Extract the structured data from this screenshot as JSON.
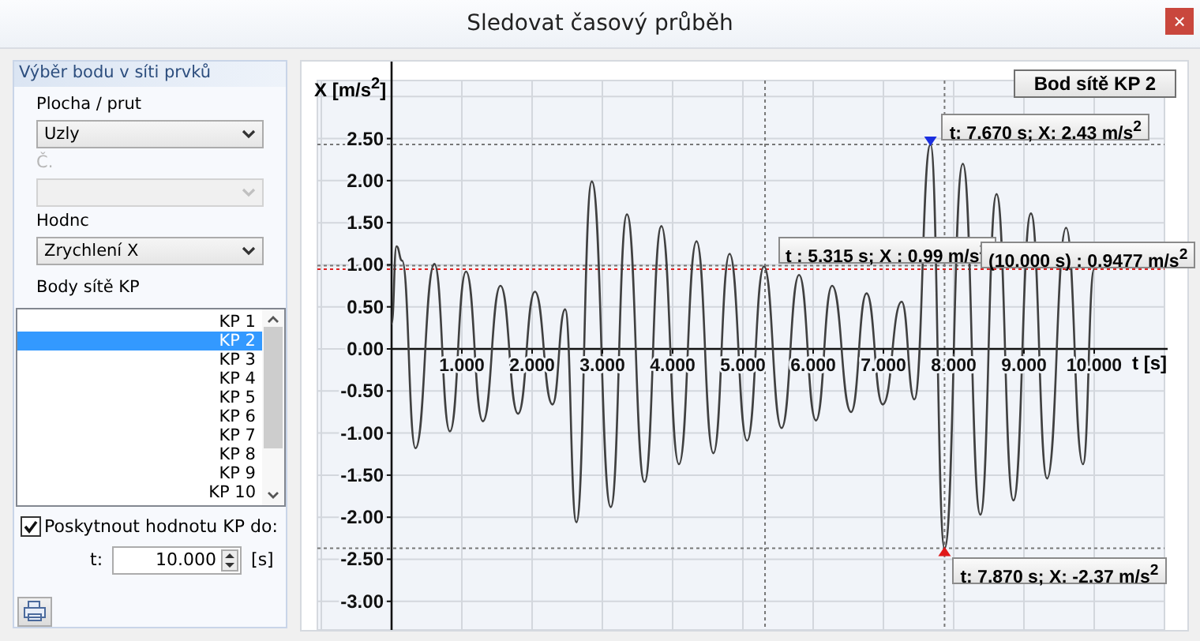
{
  "window": {
    "title": "Sledovat časový průběh",
    "close": "×"
  },
  "point_selection": {
    "title": "Výběr bodu v síti prvků",
    "fields": [
      {
        "label": "Plocha / prut",
        "value": "Uzly",
        "disabled": false
      },
      {
        "label": "Č.",
        "disabled": true
      },
      {
        "label": "Hodnc",
        "value": "Zrychlení X",
        "disabled": false
      }
    ],
    "mesh_points_label": "Body sítě KP",
    "mesh_points": [
      {
        "label": "KP 1",
        "selected": false
      },
      {
        "label": "KP 2",
        "selected": true
      },
      {
        "label": "KP 3",
        "selected": false
      },
      {
        "label": "KP 4",
        "selected": false
      },
      {
        "label": "KP 5",
        "selected": false
      },
      {
        "label": "KP 6",
        "selected": false
      },
      {
        "label": "KP 7",
        "selected": false
      },
      {
        "label": "KP 8",
        "selected": false
      },
      {
        "label": "KP 9",
        "selected": false
      },
      {
        "label": "KP 10",
        "selected": false
      }
    ],
    "limit": {
      "label": "Poskytnout hodnotu KP do:",
      "checked": true,
      "field_label": "t:",
      "value": "10.000",
      "unit": "[s]"
    }
  },
  "chart": {
    "chart_data": {
      "type": "line",
      "xlabel": "t [s]",
      "ylabel": "X [m/s$^{2}$]",
      "grid": true,
      "xlim": [
        -1,
        11
      ],
      "ylim": [
        -3.34,
        3.19
      ],
      "xticks": [
        {
          "value": 1,
          "label": "1.000"
        },
        {
          "value": 2,
          "label": "2.000"
        },
        {
          "value": 3,
          "label": "3.000"
        },
        {
          "value": 4,
          "label": "4.000"
        },
        {
          "value": 5,
          "label": "5.000"
        },
        {
          "value": 6,
          "label": "6.000"
        },
        {
          "value": 7,
          "label": "7.000"
        },
        {
          "value": 8,
          "label": "8.000"
        },
        {
          "value": 9,
          "label": "9.000"
        },
        {
          "value": 10,
          "label": "10.000"
        }
      ],
      "yticks": [
        {
          "value": 2.5,
          "label": "2.50"
        },
        {
          "value": 2,
          "label": "2.00"
        },
        {
          "value": 1.5,
          "label": "1.50"
        },
        {
          "value": 1,
          "label": "1.00"
        },
        {
          "value": 0.5,
          "label": "0.50"
        },
        {
          "value": 0,
          "label": "0.00"
        },
        {
          "value": -0.5,
          "label": "-0.50"
        },
        {
          "value": -1,
          "label": "-1.00"
        },
        {
          "value": -1.5,
          "label": "-1.50"
        },
        {
          "value": -2,
          "label": "-2.00"
        },
        {
          "value": -2.5,
          "label": "-2.50"
        },
        {
          "value": -3,
          "label": "-3.00"
        }
      ],
      "x": [
        0,
        0.07,
        0.15,
        0.34,
        0.61,
        0.83,
        1.06,
        1.3,
        1.55,
        1.8,
        2.04,
        2.29,
        2.47,
        2.63,
        2.85,
        3.12,
        3.35,
        3.6,
        3.84,
        4.09,
        4.34,
        4.58,
        4.81,
        5.06,
        5.3,
        5.55,
        5.8,
        6.04,
        6.27,
        6.54,
        6.76,
        6.99,
        7.26,
        7.44,
        7.67,
        7.87,
        8.13,
        8.38,
        8.61,
        8.85,
        9.1,
        9.33,
        9.6,
        9.84,
        10
      ],
      "series": [
        {
          "name": "Bod sítě KP 2",
          "color": "#404040",
          "values": [
            0.3,
            1.22,
            1.05,
            -1.18,
            1.01,
            -0.98,
            0.92,
            -0.86,
            0.75,
            -0.77,
            0.68,
            -0.66,
            0.47,
            -2.06,
            1.99,
            -1.88,
            1.6,
            -1.58,
            1.46,
            -1.37,
            1.28,
            -1.24,
            1.13,
            -1.09,
            0.98,
            -0.94,
            0.88,
            -0.85,
            0.75,
            -0.75,
            0.66,
            -0.66,
            0.56,
            -0.6,
            2.43,
            -2.37,
            2.2,
            -1.97,
            1.84,
            -1.8,
            1.61,
            -1.54,
            1.44,
            -1.37,
            0.95
          ]
        }
      ],
      "ref_lines": [
        {
          "axis": "y",
          "value": 2.43,
          "color": "#777777"
        },
        {
          "axis": "y",
          "value": -2.37,
          "color": "#777777"
        },
        {
          "axis": "x",
          "value": 7.87,
          "color": "#777777"
        },
        {
          "axis": "x",
          "value": 5.315,
          "color": "#777777"
        },
        {
          "axis": "y",
          "value": 0.99,
          "color": "#777777"
        },
        {
          "axis": "y",
          "value": 0.9477,
          "color": "#e02020"
        }
      ],
      "annotations": [
        {
          "text": "t: 7.670 s; X: 2.43 m/s$^{2}$",
          "x": 7.67,
          "y": 2.43
        },
        {
          "text": "t: 7.870 s; X: -2.37 m/s$^{2}$",
          "x": 7.87,
          "y": -2.37
        },
        {
          "text": "t : 5.315 s; X : 0.99 m/s$^{2}$",
          "x": 5.315,
          "y": 0.99
        },
        {
          "text": "(10.000 s) : 0.9477 m/s$^{2}$",
          "x": 10,
          "y": 0.9477
        }
      ]
    }
  }
}
